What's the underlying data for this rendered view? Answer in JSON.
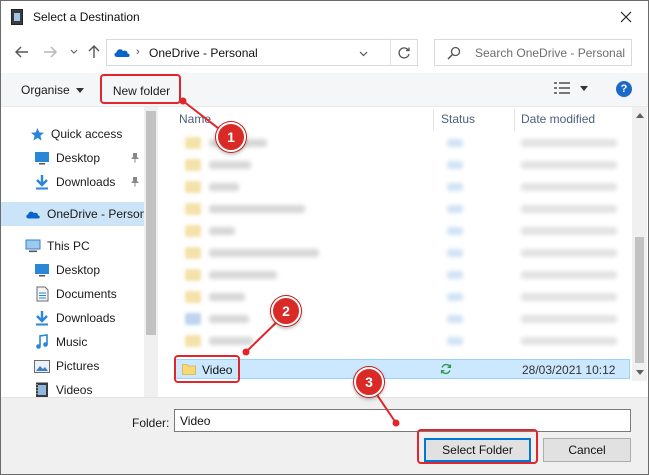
{
  "window": {
    "title": "Select a Destination"
  },
  "navigation": {
    "address_crumb": "OneDrive - Personal",
    "search_placeholder": "Search OneDrive - Personal"
  },
  "commands": {
    "organise_label": "Organise",
    "new_folder_label": "New folder"
  },
  "sidebar": {
    "items": [
      {
        "label": "Quick access",
        "icon": "star-icon"
      },
      {
        "label": "Desktop",
        "icon": "desktop-icon",
        "pinned": true
      },
      {
        "label": "Downloads",
        "icon": "download-icon",
        "pinned": true
      },
      {
        "label": "OneDrive - Personal",
        "icon": "cloud-icon",
        "selected": true
      },
      {
        "label": "This PC",
        "icon": "computer-icon"
      },
      {
        "label": "Desktop",
        "icon": "desktop-icon"
      },
      {
        "label": "Documents",
        "icon": "document-icon"
      },
      {
        "label": "Downloads",
        "icon": "download-icon"
      },
      {
        "label": "Music",
        "icon": "music-icon"
      },
      {
        "label": "Pictures",
        "icon": "picture-icon"
      },
      {
        "label": "Videos",
        "icon": "video-icon"
      }
    ]
  },
  "file_list": {
    "columns": [
      "Name",
      "Status",
      "Date modified"
    ],
    "selected_row": {
      "name": "Video",
      "status_icon": "sync-icon",
      "date_modified": "28/03/2021 10:12"
    }
  },
  "footer": {
    "folder_label": "Folder:",
    "folder_value": "Video",
    "select_button": "Select Folder",
    "cancel_button": "Cancel"
  },
  "annotations": {
    "badges": [
      "1",
      "2",
      "3"
    ],
    "color": "#d92a27"
  },
  "colors": {
    "accent": "#0078d7",
    "selection": "#cce8ff",
    "nav_selection": "#cce4f7"
  }
}
